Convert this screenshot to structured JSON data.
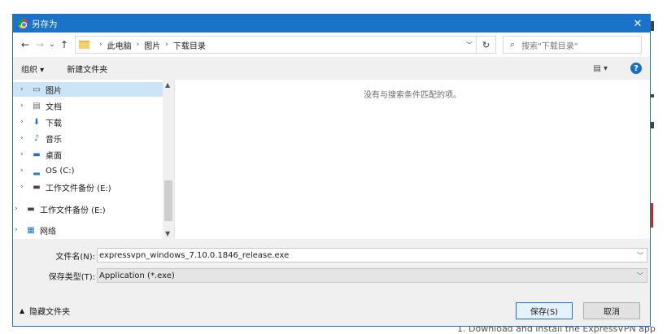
{
  "background": {
    "text": "1.  Download and install the ExpressVPN app"
  },
  "titlebar": {
    "title": "另存为",
    "close": "✕"
  },
  "nav": {
    "back": "←",
    "forward": "→",
    "recent": "⌄",
    "up": "↑",
    "breadcrumbs": [
      "此电脑",
      "图片",
      "下载目录"
    ],
    "refresh": "↻",
    "search_placeholder": "搜索\"下载目录\""
  },
  "toolbar": {
    "organize": "组织 ▾",
    "new_folder": "新建文件夹",
    "view": "▤ ▾",
    "help": "?"
  },
  "tree": {
    "items": [
      {
        "label": "图片",
        "icon": "▭"
      },
      {
        "label": "文档",
        "icon": "▤"
      },
      {
        "label": "下载",
        "icon": "⬇"
      },
      {
        "label": "音乐",
        "icon": "♪"
      },
      {
        "label": "桌面",
        "icon": "▬"
      },
      {
        "label": "OS (C:)",
        "icon": "▂"
      },
      {
        "label": "工作文件备份 (E:)",
        "icon": "▬"
      },
      {
        "label": "工作文件备份 (E:)",
        "icon": "▬"
      },
      {
        "label": "网络",
        "icon": "▦"
      }
    ]
  },
  "main": {
    "empty_message": "没有与搜索条件匹配的项。"
  },
  "fields": {
    "filename_label": "文件名(N):",
    "filename_value": "expressvpn_windows_7.10.0.1846_release.exe",
    "filetype_label": "保存类型(T):",
    "filetype_value": "Application (*.exe)"
  },
  "footer": {
    "hide_folders": "隐藏文件夹",
    "save": "保存(S)",
    "cancel": "取消"
  },
  "colors": {
    "accent": "#1a73c8",
    "selection": "#cce4f7",
    "help": "#1a6fc4"
  }
}
